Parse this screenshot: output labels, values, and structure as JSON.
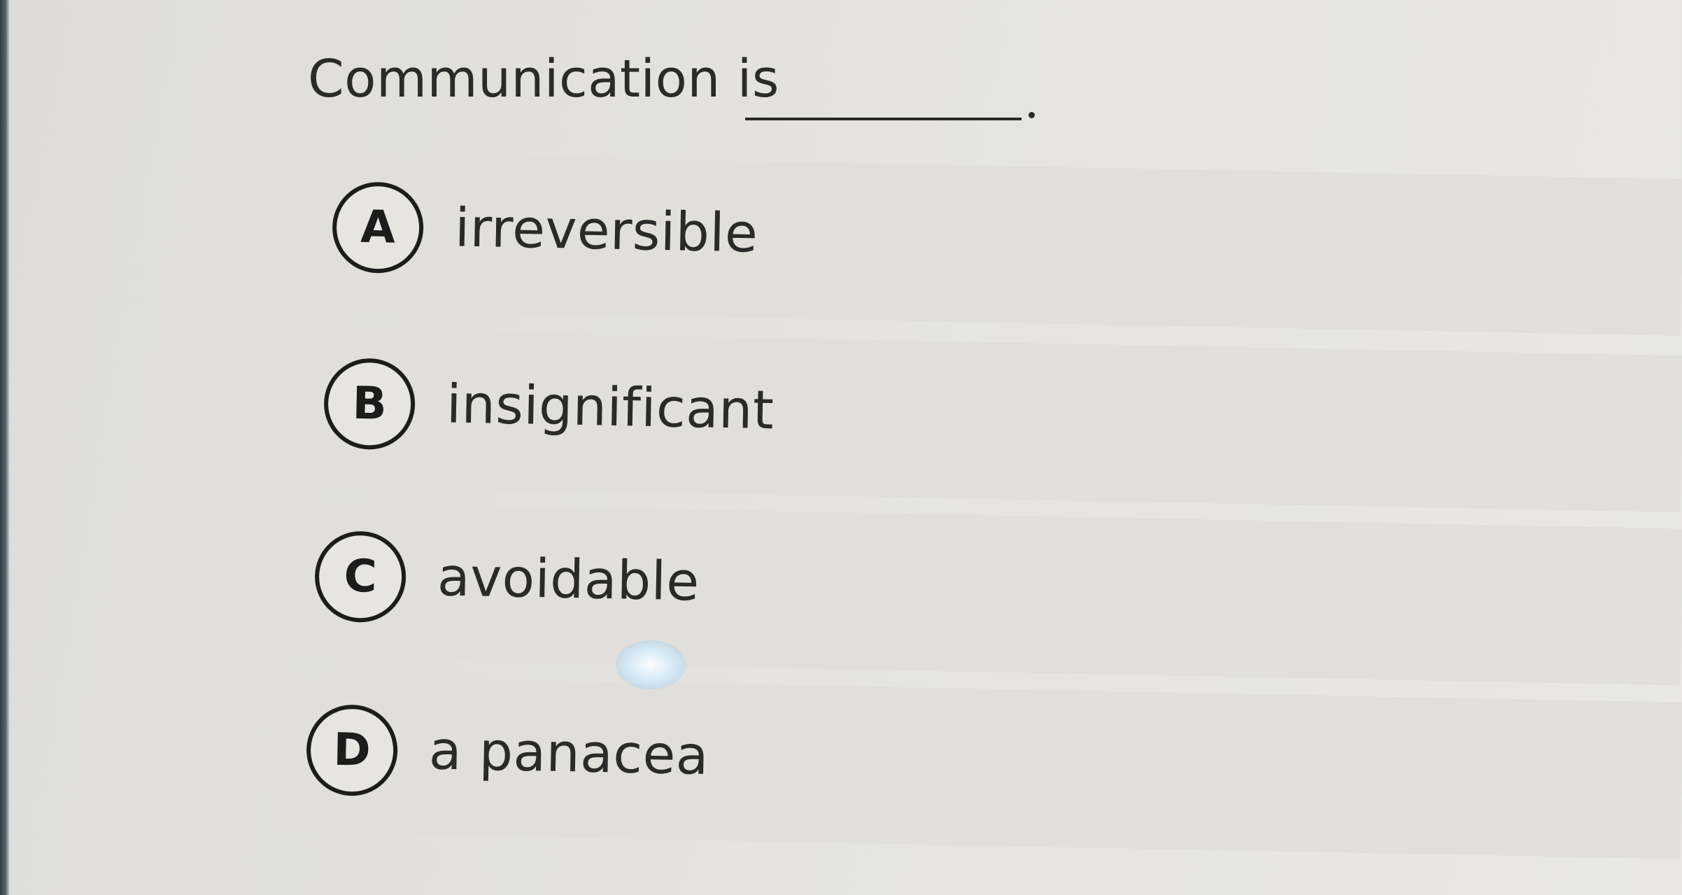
{
  "question": {
    "text": "Communication is"
  },
  "options": [
    {
      "letter": "A",
      "label": "irreversible"
    },
    {
      "letter": "B",
      "label": "insignificant"
    },
    {
      "letter": "C",
      "label": "avoidable"
    },
    {
      "letter": "D",
      "label": "a panacea"
    }
  ]
}
